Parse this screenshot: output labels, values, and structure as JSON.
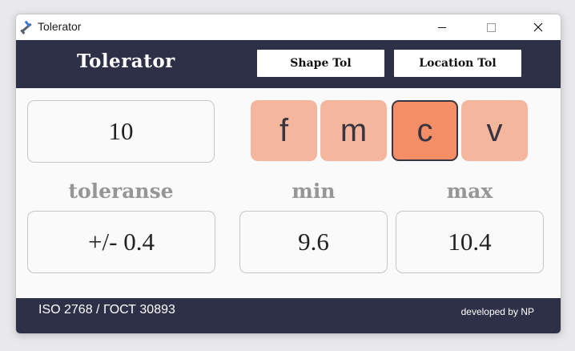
{
  "window": {
    "title": "Tolerator"
  },
  "header": {
    "brand": "Tolerator",
    "nav": {
      "shape_label": "Shape Tol",
      "location_label": "Location Tol"
    }
  },
  "main": {
    "nominal_value": "10",
    "tolerance_classes": [
      {
        "label": "f",
        "selected": false
      },
      {
        "label": "m",
        "selected": false
      },
      {
        "label": "c",
        "selected": true
      },
      {
        "label": "v",
        "selected": false
      }
    ],
    "labels": {
      "tolerance": "toleranse",
      "min": "min",
      "max": "max"
    },
    "values": {
      "tolerance": "+/- 0.4",
      "min": "9.6",
      "max": "10.4"
    }
  },
  "footer": {
    "standard": "ISO 2768 / ГОСТ 30893",
    "credit": "developed by NP"
  },
  "colors": {
    "header_bg": "#2d3047",
    "button_idle": "#f4b79d",
    "button_active": "#f38e66",
    "label_gray": "#969696"
  },
  "icons": {
    "app": "caliper-icon"
  }
}
